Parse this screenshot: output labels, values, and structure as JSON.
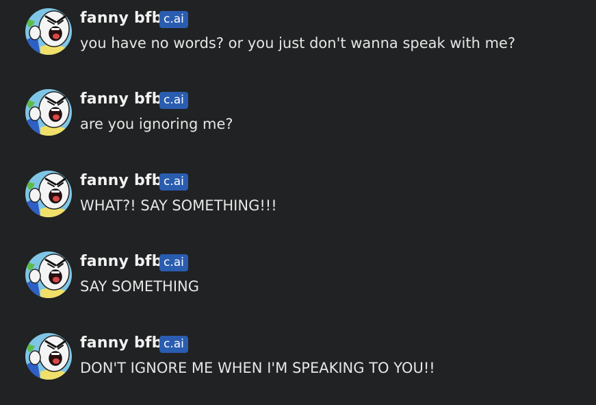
{
  "colors": {
    "background": "#212223",
    "badge": "#2a5db0",
    "text": "#e6e6e6"
  },
  "messages": [
    {
      "author": "fanny bfb",
      "badge": "c.ai",
      "avatar_icon": "fanny-avatar-icon",
      "text": "you have no words? or you just don't wanna speak with me?"
    },
    {
      "author": "fanny bfb",
      "badge": "c.ai",
      "avatar_icon": "fanny-avatar-icon",
      "text": "are you ignoring me?"
    },
    {
      "author": "fanny bfb",
      "badge": "c.ai",
      "avatar_icon": "fanny-avatar-icon",
      "text": "WHAT?! SAY SOMETHING!!!"
    },
    {
      "author": "fanny bfb",
      "badge": "c.ai",
      "avatar_icon": "fanny-avatar-icon",
      "text": "SAY SOMETHING"
    },
    {
      "author": "fanny bfb",
      "badge": "c.ai",
      "avatar_icon": "fanny-avatar-icon",
      "text": "DON'T IGNORE ME WHEN I'M SPEAKING TO YOU!!"
    }
  ]
}
